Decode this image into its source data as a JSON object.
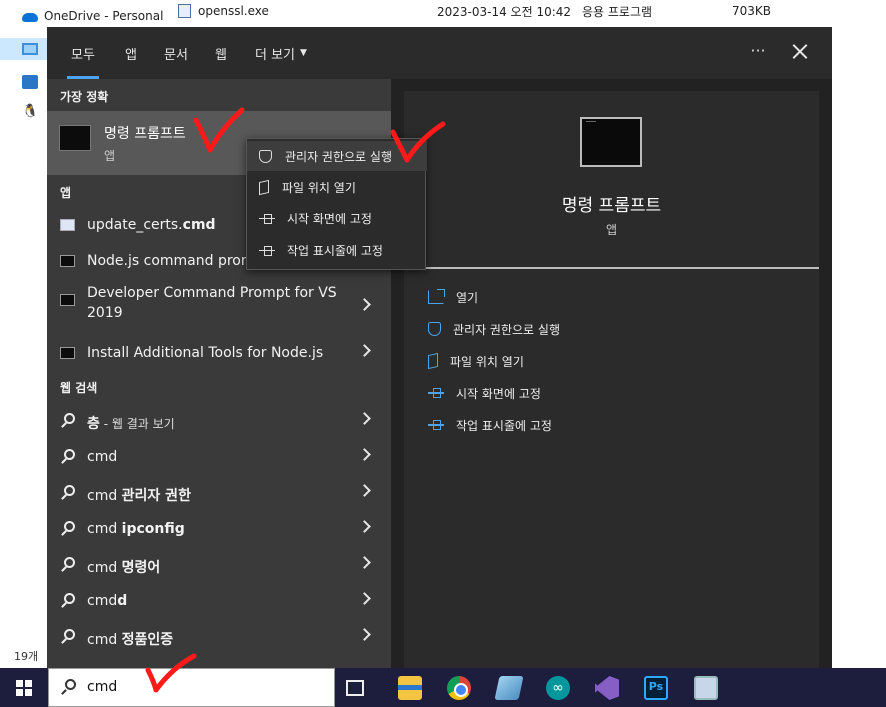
{
  "explorer": {
    "nav_items": [
      {
        "label": "OneDrive - Personal",
        "icon": "onedrive-icon"
      },
      {
        "label": "",
        "icon": "this-pc-icon",
        "selected": true
      },
      {
        "label": "",
        "icon": "network-icon"
      },
      {
        "label": "",
        "icon": "linux-icon"
      }
    ],
    "file_row": {
      "name": "openssl.exe",
      "modified": "2023-03-14 오전 10:42",
      "type": "응용 프로그램",
      "size": "703KB"
    },
    "status": "19개"
  },
  "start_menu": {
    "tabs": [
      {
        "label": "모두",
        "active": true
      },
      {
        "label": "앱"
      },
      {
        "label": "문서"
      },
      {
        "label": "웹"
      },
      {
        "label": "더 보기"
      }
    ],
    "more_options": "···",
    "best_match": {
      "heading": "가장 정확",
      "title": "명령 프롬프트",
      "subtitle": "앱"
    },
    "apps": {
      "heading": "앱",
      "items": [
        {
          "pre": "update_certs.",
          "bold": "cmd",
          "icon": "document-icon"
        },
        {
          "pre": "Node.js command prom",
          "bold": "",
          "icon": "console-icon"
        },
        {
          "pre": "Developer Command Prompt for VS 2019",
          "bold": "",
          "icon": "console-icon"
        },
        {
          "pre": "Install Additional Tools for Node.js",
          "bold": "",
          "icon": "console-icon"
        }
      ]
    },
    "web_search": {
      "heading": "웹 검색",
      "items": [
        {
          "pre": "",
          "bold": "층",
          "dim": " - 웹 결과 보기"
        },
        {
          "pre": "cmd",
          "bold": "",
          "dim": ""
        },
        {
          "pre": "cmd ",
          "bold": "관리자 권한",
          "dim": ""
        },
        {
          "pre": "cmd ",
          "bold": "ipconfig",
          "dim": ""
        },
        {
          "pre": "cmd ",
          "bold": "명령어",
          "dim": ""
        },
        {
          "pre": "cmd",
          "bold": "d",
          "dim": ""
        },
        {
          "pre": "cmd ",
          "bold": "정품인증",
          "dim": ""
        }
      ]
    },
    "context_menu": [
      {
        "label": "관리자 권한으로 실행",
        "icon": "shield-icon"
      },
      {
        "label": "파일 위치 열기",
        "icon": "folder-icon"
      },
      {
        "label": "시작 화면에 고정",
        "icon": "pin-icon"
      },
      {
        "label": "작업 표시줄에 고정",
        "icon": "pin-icon"
      }
    ],
    "detail": {
      "title": "명령 프롬프트",
      "subtitle": "앱",
      "actions": [
        {
          "label": "열기",
          "icon": "open-icon"
        },
        {
          "label": "관리자 권한으로 실행",
          "icon": "shield-icon"
        },
        {
          "label": "파일 위치 열기",
          "icon": "folder-icon"
        },
        {
          "label": "시작 화면에 고정",
          "icon": "pin-icon"
        },
        {
          "label": "작업 표시줄에 고정",
          "icon": "pin-icon"
        }
      ]
    }
  },
  "taskbar": {
    "search_value": "cmd",
    "apps": [
      "task-view-icon",
      "file-explorer-icon",
      "chrome-icon",
      "notepad-icon",
      "arduino-icon",
      "visual-studio-icon",
      "photoshop-icon",
      "remote-desktop-icon"
    ]
  },
  "colors": {
    "accent": "#4ca3f0",
    "annotation": "#ff0000",
    "taskbar": "#1d1e3e"
  }
}
